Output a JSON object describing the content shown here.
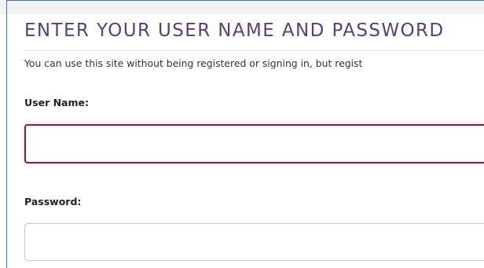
{
  "login": {
    "title": "ENTER YOUR USER NAME AND PASSWORD",
    "intro": "You can use this site without being registered or signing in, but regist",
    "username": {
      "label": "User Name:",
      "value": ""
    },
    "password": {
      "label": "Password:",
      "value": ""
    }
  },
  "colors": {
    "title": "#5a3f77",
    "active_input_border": "#7a2430",
    "input_border": "#c9c9c9",
    "frame_border": "#4a72b0"
  }
}
